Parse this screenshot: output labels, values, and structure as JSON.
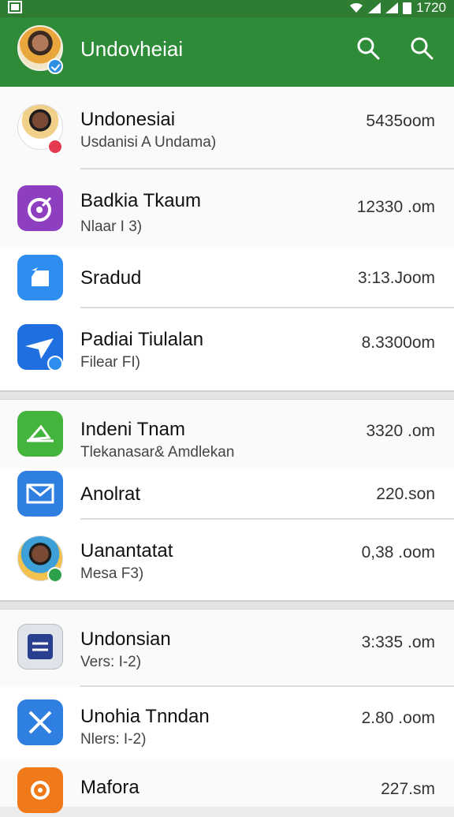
{
  "status_bar": {
    "clock": "1720"
  },
  "app_bar": {
    "title": "Undovheiai"
  },
  "colors": {
    "app_bar": "#2e8b38",
    "status_bar": "#2e7d32"
  },
  "section1": [
    {
      "title": "Undonesiai",
      "subtitle": "Usdanisi A Undama)",
      "size": "5435oom",
      "icon": "person-avatar"
    },
    {
      "title": "Badkia Tkaum",
      "subtitle": "Nlaar I 3)",
      "size": "12330 .om",
      "icon": "target-app-icon"
    },
    {
      "title": "Sradud",
      "subtitle": "",
      "size": "3:13.Joom",
      "icon": "chat-bubble-app-icon"
    },
    {
      "title": "Padiai Tiulalan",
      "subtitle": "Filear FI)",
      "size": "8.3300om",
      "icon": "paper-plane-app-icon"
    }
  ],
  "section2": [
    {
      "title": "Indeni Tnam",
      "subtitle": "Tlekanasar& Amdlekan",
      "size": "3320 .om",
      "icon": "sailboat-app-icon"
    },
    {
      "title": "Anolrat",
      "subtitle": "",
      "size": "220.son",
      "icon": "mail-app-icon"
    },
    {
      "title": "Uanantatat",
      "subtitle": "Mesa F3)",
      "size": "0,38 .oom",
      "icon": "person-avatar"
    }
  ],
  "section3": [
    {
      "title": "Undonsian",
      "subtitle": "Vers: I-2)",
      "size": "3:335 .om",
      "icon": "document-app-icon"
    },
    {
      "title": "Unohia Tnndan",
      "subtitle": "Nlers: I-2)",
      "size": "2.80 .oom",
      "icon": "close-app-icon"
    },
    {
      "title": "Mafora",
      "subtitle": "",
      "size": "227.sm",
      "icon": "gear-app-icon"
    }
  ]
}
